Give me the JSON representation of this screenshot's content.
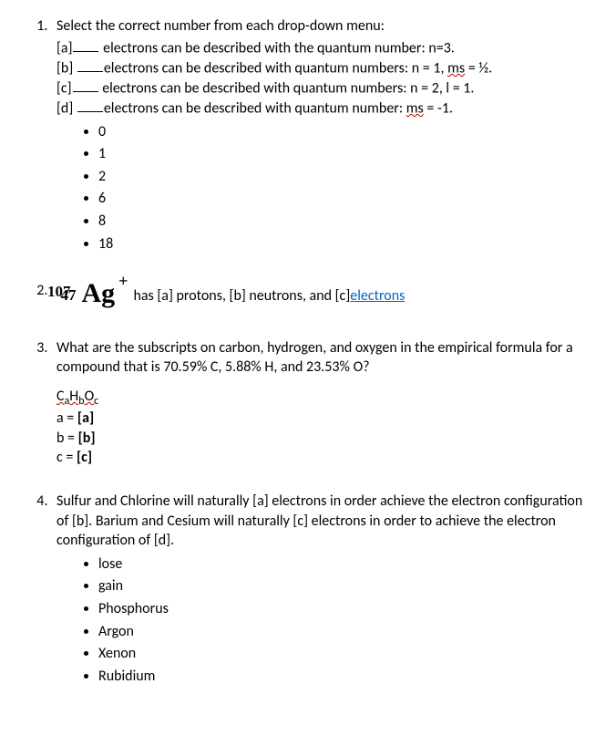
{
  "q1": {
    "prompt": "Select the correct number from each drop-down menu:",
    "a_pre": "[a]",
    "a_post": " electrons can be described with the quantum number: n=3.",
    "b_pre": "[b] ",
    "b_post_before_ms": "electrons can be described with quantum numbers: n = 1, ",
    "b_ms": "ms",
    "b_post_after_ms": " = ½.",
    "c_pre": "[c]",
    "c_post": " electrons can be described with quantum numbers: n = 2, l = 1.",
    "d_pre": "[d] ",
    "d_post_before_ms": "electrons can be described with quantum number: ",
    "d_ms": "ms",
    "d_post_after_ms": " = -1.",
    "options": [
      "0",
      "1",
      "2",
      "6",
      "8",
      "18"
    ]
  },
  "q2": {
    "mass": "107",
    "atomic": "47",
    "symbol": "Ag",
    "charge": "+",
    "text_before_link": "has [a] protons, [b] neutrons, and [c] ",
    "link": "electrons"
  },
  "q3": {
    "prompt": "What are the subscripts on carbon, hydrogen, and oxygen in the empirical formula for a compound that is 70.59% C, 5.88% H, and 23.53% O?",
    "formula_C": "C",
    "formula_a": "a",
    "formula_H": "H",
    "formula_b": "b",
    "formula_O": "O",
    "formula_c": "c",
    "line_a_l": "a = ",
    "line_a_r": "[a]",
    "line_b_l": "b = ",
    "line_b_r": "[b]",
    "line_c_l": "c = ",
    "line_c_r": "[c]"
  },
  "q4": {
    "prompt": "Sulfur and Chlorine will naturally [a] electrons in order achieve the electron configuration of [b].  Barium and Cesium will naturally [c] electrons in order to achieve the electron configuration of [d].",
    "options": [
      "lose",
      "gain",
      "Phosphorus",
      "Argon",
      "Xenon",
      "Rubidium"
    ]
  }
}
